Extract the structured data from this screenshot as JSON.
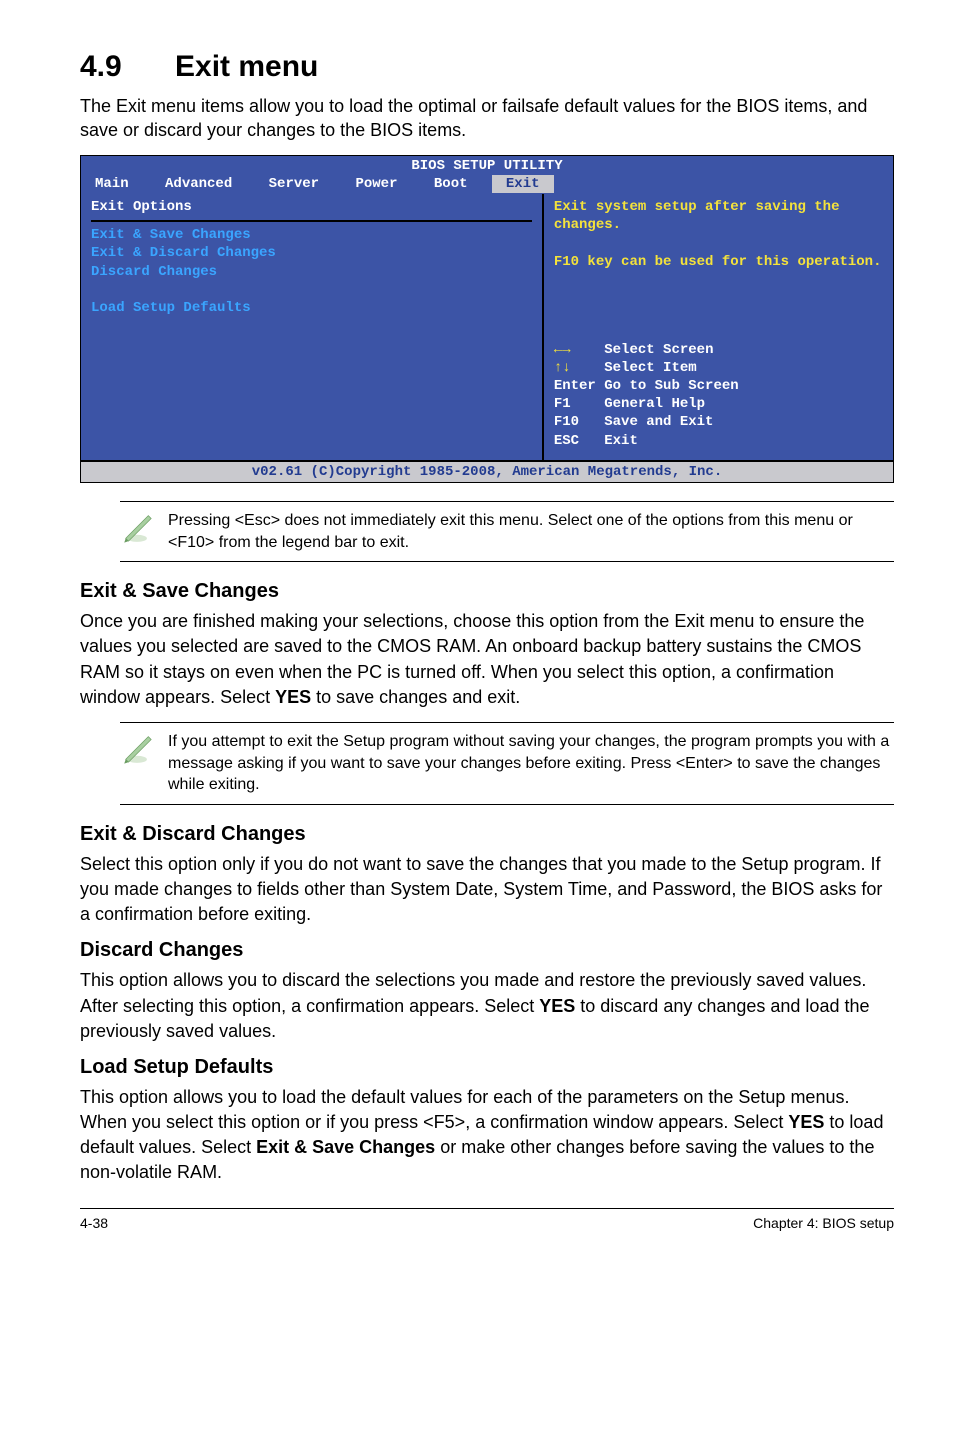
{
  "heading": {
    "number": "4.9",
    "title": "Exit menu"
  },
  "intro": "The Exit menu items allow you to load the optimal or failsafe default values for the BIOS items, and save or discard your changes to the BIOS items.",
  "bios": {
    "title": "BIOS SETUP UTILITY",
    "tabs": {
      "main": "Main",
      "advanced": "Advanced",
      "server": "Server",
      "power": "Power",
      "boot": "Boot",
      "exit": "Exit"
    },
    "left": {
      "heading": "Exit Options",
      "opt1": "Exit & Save Changes",
      "opt2": "Exit & Discard Changes",
      "opt3": "Discard Changes",
      "opt4": "Load Setup Defaults"
    },
    "right": {
      "help1": "Exit system setup after saving the changes.",
      "help2": "F10 key can be used for this operation.",
      "nav_select_screen_arrows": "←→",
      "nav_select_screen": "    Select Screen",
      "nav_select_item_arrows": "↑↓",
      "nav_select_item": "    Select Item",
      "nav_enter": "Enter Go to Sub Screen",
      "nav_f1": "F1    General Help",
      "nav_f10": "F10   Save and Exit",
      "nav_esc": "ESC   Exit"
    },
    "footer": "v02.61 (C)Copyright 1985-2008, American Megatrends, Inc."
  },
  "note1": "Pressing <Esc> does not immediately exit this menu. Select one of the options from this menu or <F10> from the legend bar to exit.",
  "s1": {
    "title": "Exit & Save Changes",
    "p_a": "Once you are finished making your selections, choose this option from the Exit menu to ensure the values you selected are saved to the CMOS RAM. An onboard backup battery sustains the CMOS RAM so it stays on even when the PC is turned off. When you select this option, a confirmation window appears. Select ",
    "p_b": "YES",
    "p_c": " to save changes and exit."
  },
  "note2": "If you attempt to exit the Setup program without saving your changes, the program prompts you with a message asking if you want to save your changes before exiting. Press <Enter> to save the changes while exiting.",
  "s2": {
    "title": "Exit & Discard Changes",
    "p": "Select this option only if you do not want to save the changes that you made to the Setup program. If you made changes to fields other than System Date, System Time, and Password, the BIOS asks for a confirmation before exiting."
  },
  "s3": {
    "title": "Discard Changes",
    "p_a": "This option allows you to discard the selections you made and restore the previously saved values. After selecting this option, a confirmation appears. Select ",
    "p_b": "YES",
    "p_c": " to discard any changes and load the previously saved values."
  },
  "s4": {
    "title": "Load Setup Defaults",
    "p_a": "This option allows you to load the default values for each of the parameters on the Setup menus. When you select this option or if you press <F5>, a confirmation window appears. Select ",
    "p_b": "YES",
    "p_c": " to load default values. Select ",
    "p_d": "Exit & Save Changes",
    "p_e": " or make other changes before saving the values to the non-volatile RAM."
  },
  "footer": {
    "left": "4-38",
    "right": "Chapter 4: BIOS setup"
  }
}
